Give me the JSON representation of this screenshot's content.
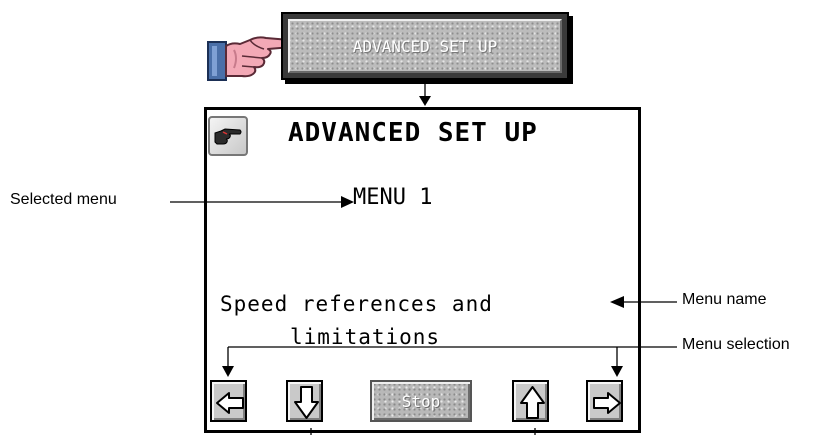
{
  "top_button": {
    "label": "ADVANCED SET UP"
  },
  "panel": {
    "title": "ADVANCED SET UP",
    "icon": "pointing-hand-icon",
    "selected_menu": "MENU 1",
    "menu_name_line1": "Speed references and",
    "menu_name_line2": "limitations"
  },
  "controls": {
    "left": "arrow-left-icon",
    "down": "arrow-down-icon",
    "stop_label": "Stop",
    "up": "arrow-up-icon",
    "right": "arrow-right-icon"
  },
  "callouts": {
    "selected_menu": "Selected menu",
    "menu_name": "Menu name",
    "menu_selection": "Menu selection"
  },
  "colors": {
    "button_face": "#c9c9c9",
    "hand_skin": "#f3a9b6",
    "sleeve": "#4a6fa8"
  }
}
